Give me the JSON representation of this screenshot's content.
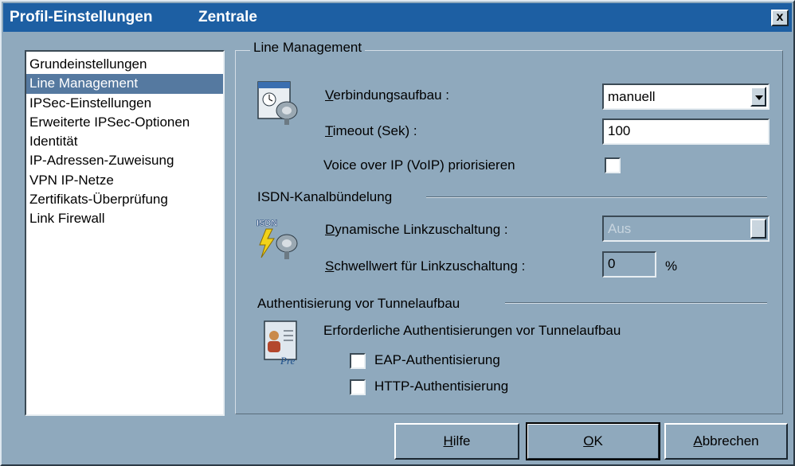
{
  "window": {
    "title": "Profil-Einstellungen",
    "profile_name": "Zentrale",
    "close_label": "x"
  },
  "nav": {
    "items": [
      {
        "label": "Grundeinstellungen"
      },
      {
        "label": "Line Management",
        "selected": true
      },
      {
        "label": "IPSec-Einstellungen"
      },
      {
        "label": "Erweiterte IPSec-Optionen"
      },
      {
        "label": "Identität"
      },
      {
        "label": "IP-Adressen-Zuweisung"
      },
      {
        "label": "VPN IP-Netze"
      },
      {
        "label": "Zertifikats-Überprüfung"
      },
      {
        "label": "Link Firewall"
      }
    ]
  },
  "line_management": {
    "title": "Line Management",
    "connection": {
      "label_u": "V",
      "label_rest": "erbindungsaufbau :",
      "value": "manuell"
    },
    "timeout": {
      "label_u": "T",
      "label_rest": "imeout (Sek) :",
      "value": "100"
    },
    "voip": {
      "label": "Voice over IP (VoIP) priorisieren",
      "checked": false
    }
  },
  "isdn": {
    "title": "ISDN-Kanalbündelung",
    "icon_text": "ISDN",
    "dynamic": {
      "label_u": "D",
      "label_rest": "ynamische Linkzuschaltung :",
      "value": "Aus",
      "disabled": true
    },
    "threshold": {
      "label_u": "S",
      "label_rest": "chwellwert für Linkzuschaltung :",
      "value": "0",
      "unit": "%",
      "disabled": true
    }
  },
  "auth": {
    "title": "Authentisierung vor Tunnelaufbau",
    "icon_text": "Pre",
    "description": "Erforderliche Authentisierungen vor Tunnelaufbau",
    "eap": {
      "label": "EAP-Authentisierung",
      "checked": false
    },
    "http": {
      "label": "HTTP-Authentisierung",
      "checked": false
    }
  },
  "buttons": {
    "help": {
      "u": "H",
      "rest": "ilfe"
    },
    "ok": {
      "u": "O",
      "rest": "K"
    },
    "cancel": {
      "u": "A",
      "rest": "bbrechen"
    }
  },
  "colors": {
    "titlebar": "#1d5fa3",
    "dialog_bg": "#8fa9bd",
    "selection": "#5579a0"
  }
}
